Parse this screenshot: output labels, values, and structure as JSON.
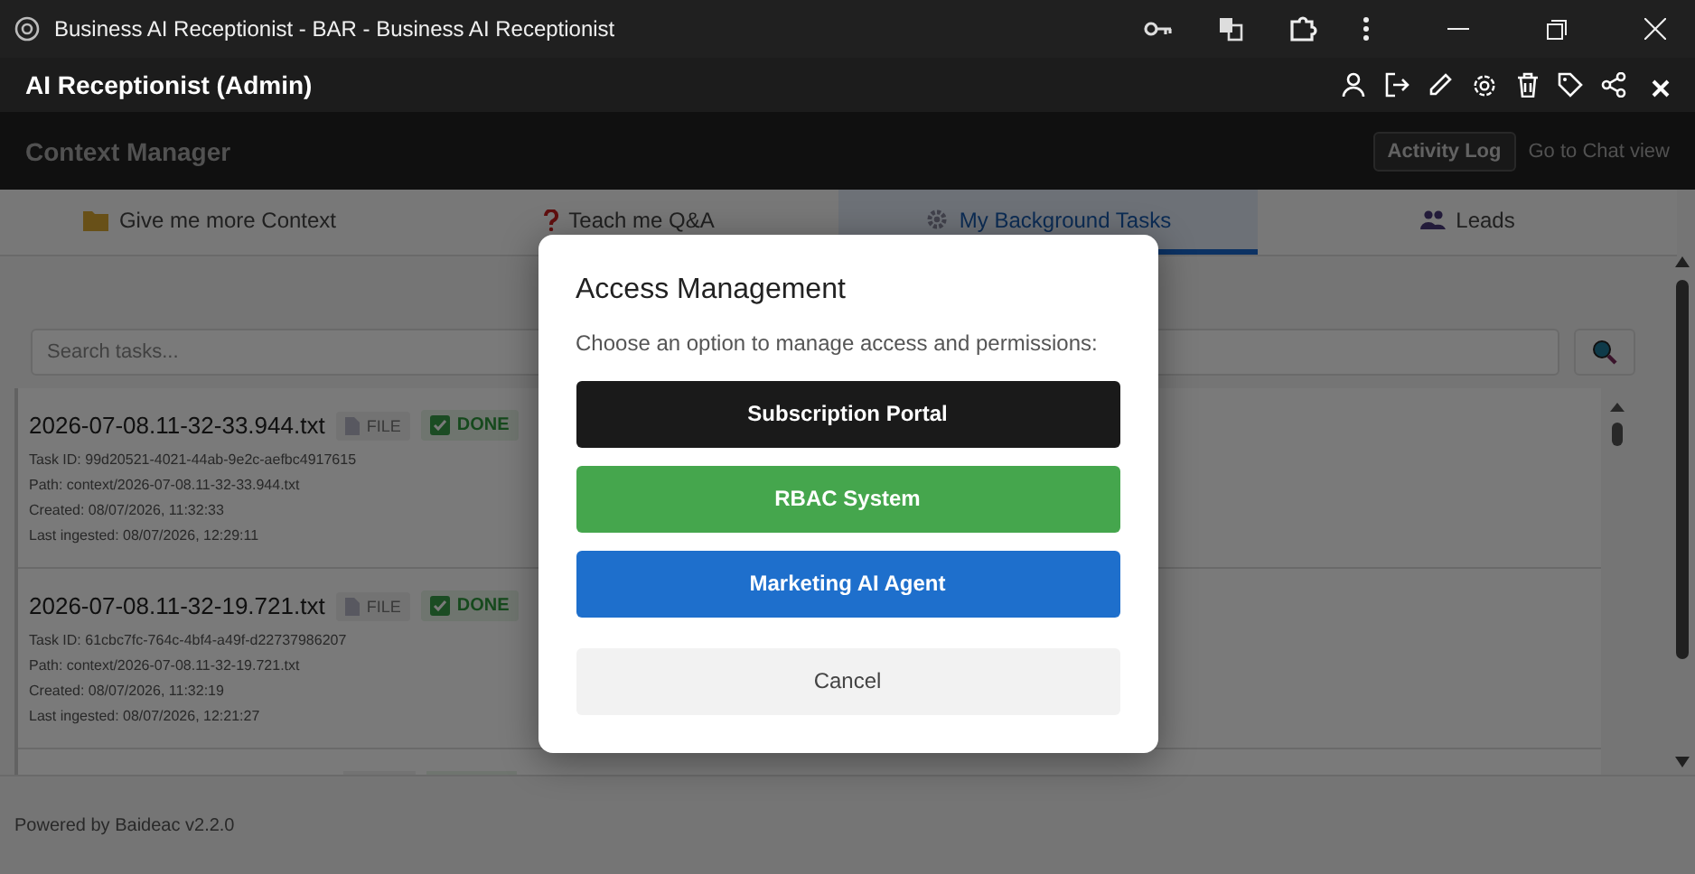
{
  "window": {
    "title": "Business AI Receptionist - BAR - Business AI Receptionist"
  },
  "app_header": {
    "title": "AI Receptionist (Admin)"
  },
  "context_bar": {
    "title": "Context Manager",
    "activity_log": "Activity Log",
    "chat_link": "Go to Chat view"
  },
  "tabs": [
    {
      "label": "Give me more Context",
      "selected": false
    },
    {
      "label": "Teach me Q&A",
      "selected": false
    },
    {
      "label": "My Background Tasks",
      "selected": true
    },
    {
      "label": "Leads",
      "selected": false
    }
  ],
  "search": {
    "placeholder": "Search tasks..."
  },
  "tasks": [
    {
      "name": "2026-07-08.11-32-33.944.txt",
      "type": "FILE",
      "status": "DONE",
      "task_id": "Task ID: 99d20521-4021-44ab-9e2c-aefbc4917615",
      "path": "Path: context/2026-07-08.11-32-33.944.txt",
      "created": "Created: 08/07/2026, 11:32:33",
      "last_ingested": "Last ingested: 08/07/2026, 12:29:11"
    },
    {
      "name": "2026-07-08.11-32-19.721.txt",
      "type": "FILE",
      "status": "DONE",
      "task_id": "Task ID: 61cbc7fc-764c-4bf4-a49f-d22737986207",
      "path": "Path: context/2026-07-08.11-32-19.721.txt",
      "created": "Created: 08/07/2026, 11:32:19",
      "last_ingested": "Last ingested: 08/07/2026, 12:21:27"
    }
  ],
  "footer": "Powered by Baideac v2.2.0",
  "dialog": {
    "title": "Access Management",
    "message": "Choose an option to manage access and permissions:",
    "options": [
      {
        "label": "Subscription Portal",
        "kind": "dark"
      },
      {
        "label": "RBAC System",
        "kind": "green"
      },
      {
        "label": "Marketing AI Agent",
        "kind": "blue"
      }
    ],
    "cancel": "Cancel"
  }
}
